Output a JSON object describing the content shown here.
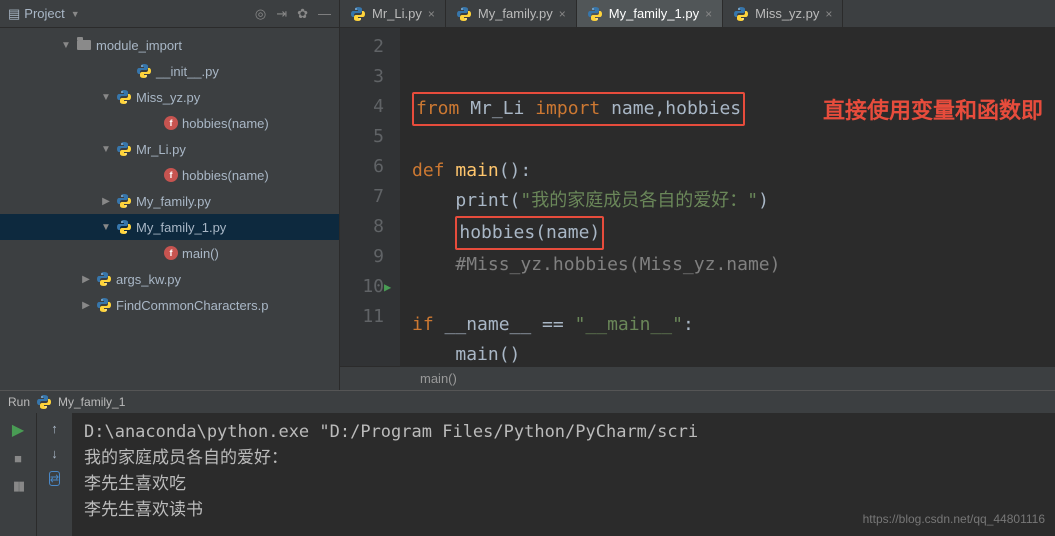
{
  "sidebar": {
    "title": "Project",
    "actions": [
      "target-icon",
      "collapse-icon",
      "gear-icon",
      "hide-icon"
    ],
    "tree": [
      {
        "indent": 60,
        "arrow": "▼",
        "type": "folder",
        "label": "module_import"
      },
      {
        "indent": 120,
        "arrow": "",
        "type": "py",
        "label": "__init__.py"
      },
      {
        "indent": 100,
        "arrow": "▼",
        "type": "py",
        "label": "Miss_yz.py"
      },
      {
        "indent": 148,
        "arrow": "",
        "type": "method",
        "label": "hobbies(name)"
      },
      {
        "indent": 100,
        "arrow": "▼",
        "type": "py",
        "label": "Mr_Li.py"
      },
      {
        "indent": 148,
        "arrow": "",
        "type": "method",
        "label": "hobbies(name)"
      },
      {
        "indent": 100,
        "arrow": "▶",
        "type": "py",
        "label": "My_family.py"
      },
      {
        "indent": 100,
        "arrow": "▼",
        "type": "py",
        "label": "My_family_1.py",
        "selected": true
      },
      {
        "indent": 148,
        "arrow": "",
        "type": "method",
        "label": "main()"
      },
      {
        "indent": 80,
        "arrow": "▶",
        "type": "py",
        "label": "args_kw.py"
      },
      {
        "indent": 80,
        "arrow": "▶",
        "type": "py",
        "label": "FindCommonCharacters.p"
      }
    ]
  },
  "tabs": [
    {
      "label": "Mr_Li.py",
      "active": false
    },
    {
      "label": "My_family.py",
      "active": false
    },
    {
      "label": "My_family_1.py",
      "active": true
    },
    {
      "label": "Miss_yz.py",
      "active": false
    }
  ],
  "code": {
    "lines": [
      "2",
      "3",
      "4",
      "5",
      "6",
      "7",
      "8",
      "9",
      "10",
      "11"
    ],
    "line3_from": "from",
    "line3_mod": " Mr_Li ",
    "line3_import": "import",
    "line3_names": " name,hobbies",
    "line5_def": "def ",
    "line5_fn": "main",
    "line5_paren": "():",
    "line6_fn": "print",
    "line6_open": "(",
    "line6_str": "\"我的家庭成员各自的爱好：\"",
    "line6_close": ")",
    "line7_call": "hobbies(name)",
    "line8_comment": "#Miss_yz.hobbies(Miss_yz.name)",
    "line10_if": "if ",
    "line10_name": "__name__",
    "line10_eq": " == ",
    "line10_str": "\"__main__\"",
    "line10_colon": ":",
    "line11_call": "main()",
    "annotation": "直接使用变量和函数即",
    "breadcrumb": "main()"
  },
  "run": {
    "title_prefix": "Run",
    "title": "My_family_1",
    "output_line1": "D:\\anaconda\\python.exe \"D:/Program Files/Python/PyCharm/scri",
    "output_line2": "我的家庭成员各自的爱好：",
    "output_line3": "李先生喜欢吃",
    "output_line4": "李先生喜欢读书",
    "watermark": "https://blog.csdn.net/qq_44801116"
  }
}
